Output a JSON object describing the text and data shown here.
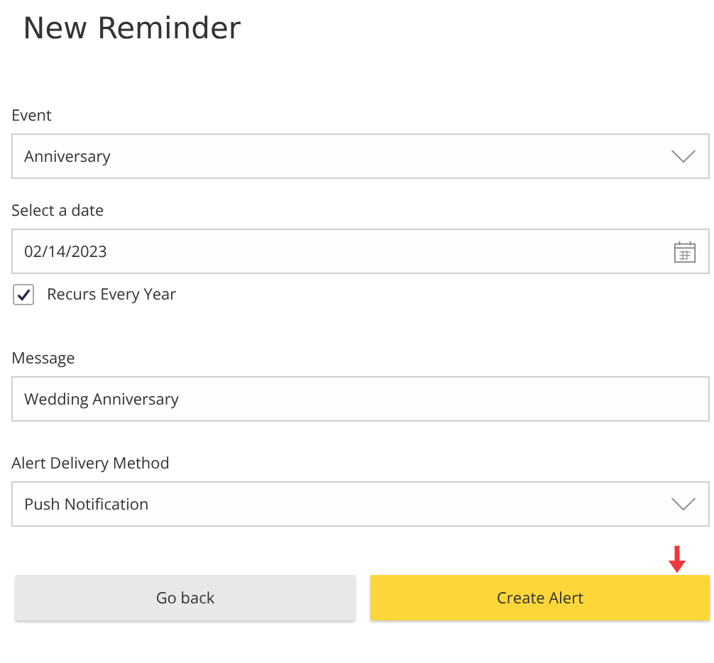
{
  "title": "New Reminder",
  "form": [
    {
      "kind": "select",
      "label": "Event",
      "value": "Anniversary"
    },
    {
      "kind": "date",
      "label": "Select a date",
      "value": "02/14/2023"
    },
    {
      "kind": "checkbox",
      "label": "Recurs Every Year",
      "checked": true
    },
    {
      "kind": "text",
      "label": "Message",
      "value": "Wedding Anniversary"
    },
    {
      "kind": "select",
      "label": "Alert Delivery Method",
      "value": "Push Notification"
    }
  ],
  "buttons": [
    {
      "kind": "secondary",
      "label": "Go back"
    },
    {
      "kind": "primary",
      "label": "Create Alert"
    }
  ]
}
